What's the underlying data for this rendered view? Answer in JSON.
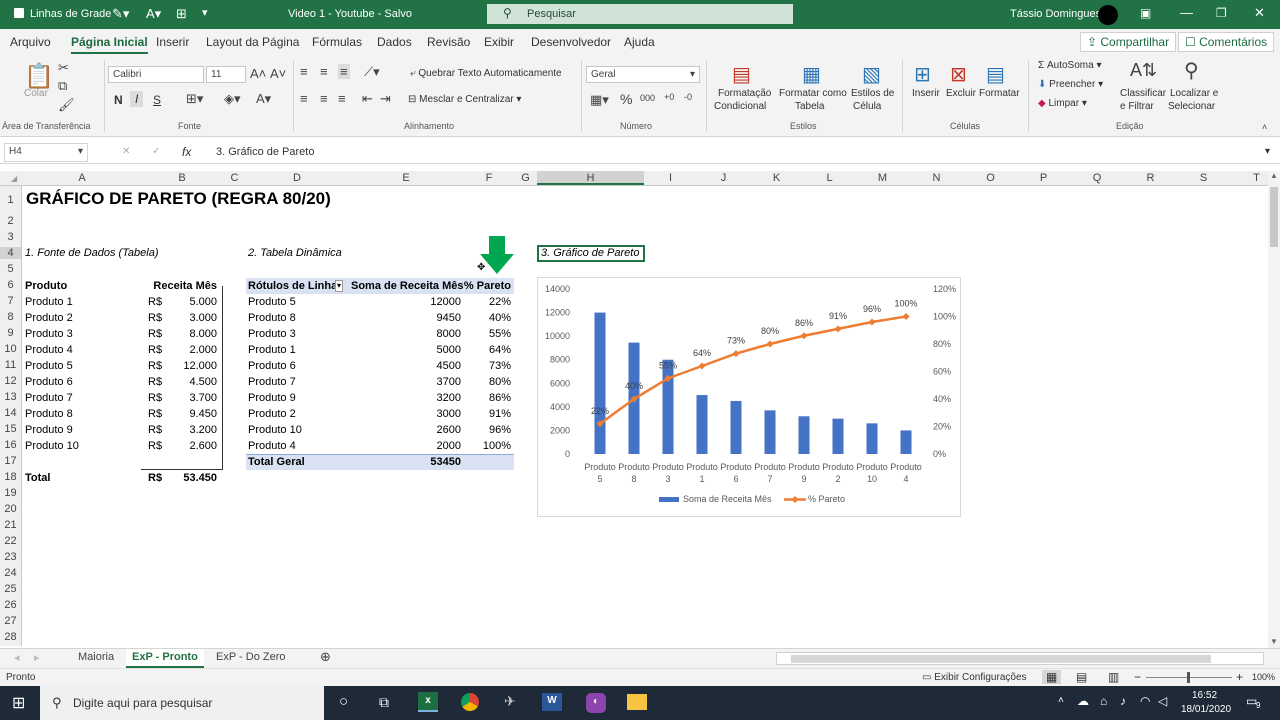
{
  "titlebar": {
    "gridlines_label": "Linhas de Grade",
    "doc_title": "Video 1 - Youtube  -  Salvo",
    "search_placeholder": "Pesquisar",
    "user_name": "Tássio Domingues"
  },
  "menu": [
    "Arquivo",
    "Página Inicial",
    "Inserir",
    "Layout da Página",
    "Fórmulas",
    "Dados",
    "Revisão",
    "Exibir",
    "Desenvolvedor",
    "Ajuda"
  ],
  "menu_right": {
    "share": "Compartilhar",
    "comments": "Comentários"
  },
  "ribbon": {
    "paste": "Colar",
    "font_name": "Calibri",
    "font_size": "11",
    "bold": "N",
    "italic": "I",
    "underline": "S",
    "wrap_text": "Quebrar Texto Automaticamente",
    "merge_center": "Mesclar e Centralizar",
    "number_format": "Geral",
    "cond_format": [
      "Formatação",
      "Condicional"
    ],
    "format_table": [
      "Formatar como",
      "Tabela"
    ],
    "cell_styles": [
      "Estilos de",
      "Célula"
    ],
    "insert": "Inserir",
    "delete": "Excluir",
    "format": "Formatar",
    "autosum": "AutoSoma",
    "fill": "Preencher",
    "clear": "Limpar",
    "sort_filter": [
      "Classificar",
      "e Filtrar"
    ],
    "find_select": [
      "Localizar e",
      "Selecionar"
    ],
    "groups": [
      "Área de Transferência",
      "Fonte",
      "Alinhamento",
      "Número",
      "Estilos",
      "Células",
      "Edição"
    ]
  },
  "formula_bar": {
    "name_box": "H4",
    "fx": "fx",
    "content": "3. Gráfico de Pareto"
  },
  "columns": [
    "A",
    "B",
    "C",
    "D",
    "E",
    "F",
    "G",
    "H",
    "I",
    "J",
    "K",
    "L",
    "M",
    "N",
    "O",
    "P",
    "Q",
    "R",
    "S",
    "T"
  ],
  "rows": [
    "1",
    "2",
    "3",
    "4",
    "5",
    "6",
    "7",
    "8",
    "9",
    "10",
    "11",
    "12",
    "13",
    "14",
    "15",
    "16",
    "17",
    "18",
    "19",
    "20",
    "21",
    "22",
    "23",
    "24",
    "25",
    "26",
    "27",
    "28"
  ],
  "sheet": {
    "title": "GRÁFICO DE PARETO (REGRA 80/20)",
    "sec1": "1. Fonte de Dados (Tabela)",
    "sec2": "2. Tabela Dinâmica",
    "sec3": "3. Gráfico de Pareto",
    "source_headers": [
      "Produto",
      "Receita Mês"
    ],
    "source_rows": [
      [
        "Produto 1",
        "R$",
        "5.000"
      ],
      [
        "Produto 2",
        "R$",
        "3.000"
      ],
      [
        "Produto 3",
        "R$",
        "8.000"
      ],
      [
        "Produto 4",
        "R$",
        "2.000"
      ],
      [
        "Produto 5",
        "R$",
        "12.000"
      ],
      [
        "Produto 6",
        "R$",
        "4.500"
      ],
      [
        "Produto 7",
        "R$",
        "3.700"
      ],
      [
        "Produto 8",
        "R$",
        "9.450"
      ],
      [
        "Produto 9",
        "R$",
        "3.200"
      ],
      [
        "Produto 10",
        "R$",
        "2.600"
      ]
    ],
    "source_total": [
      "Total",
      "R$",
      "53.450"
    ],
    "pivot_headers": [
      "Rótulos de Linha",
      "Soma de Receita Mês",
      "% Pareto"
    ],
    "pivot_rows": [
      [
        "Produto 5",
        "12000",
        "22%"
      ],
      [
        "Produto 8",
        "9450",
        "40%"
      ],
      [
        "Produto 3",
        "8000",
        "55%"
      ],
      [
        "Produto 1",
        "5000",
        "64%"
      ],
      [
        "Produto 6",
        "4500",
        "73%"
      ],
      [
        "Produto 7",
        "3700",
        "80%"
      ],
      [
        "Produto 9",
        "3200",
        "86%"
      ],
      [
        "Produto 2",
        "3000",
        "91%"
      ],
      [
        "Produto 10",
        "2600",
        "96%"
      ],
      [
        "Produto 4",
        "2000",
        "100%"
      ]
    ],
    "pivot_total": [
      "Total Geral",
      "53450"
    ]
  },
  "chart_data": {
    "type": "bar",
    "categories": [
      "Produto 5",
      "Produto 8",
      "Produto 3",
      "Produto 1",
      "Produto 6",
      "Produto 7",
      "Produto 9",
      "Produto 2",
      "Produto 10",
      "Produto 4"
    ],
    "series": [
      {
        "name": "Soma de Receita Mês",
        "type": "bar",
        "axis": "left",
        "color": "#4472c4",
        "values": [
          12000,
          9450,
          8000,
          5000,
          4500,
          3700,
          3200,
          3000,
          2600,
          2000
        ]
      },
      {
        "name": "% Pareto",
        "type": "line",
        "axis": "right",
        "color": "#ed7d31",
        "values": [
          22,
          40,
          55,
          64,
          73,
          80,
          86,
          91,
          96,
          100
        ]
      }
    ],
    "point_labels": [
      "22%",
      "40%",
      "55%",
      "64%",
      "73%",
      "80%",
      "86%",
      "91%",
      "96%",
      "100%"
    ],
    "y_left_ticks": [
      "0",
      "2000",
      "4000",
      "6000",
      "8000",
      "10000",
      "12000",
      "14000"
    ],
    "y_right_ticks": [
      "0%",
      "20%",
      "40%",
      "60%",
      "80%",
      "100%",
      "120%"
    ],
    "ylim_left": [
      0,
      14000
    ],
    "ylim_right": [
      0,
      120
    ],
    "legend": "bottom",
    "grid": false
  },
  "sheet_tabs": [
    "Maioria",
    "ExP - Pronto",
    "ExP - Do Zero"
  ],
  "active_tab": "ExP - Pronto",
  "status": {
    "ready": "Pronto",
    "display_settings": "Exibir Configurações",
    "zoom": "100%"
  },
  "taskbar": {
    "search_placeholder": "Digite aqui para pesquisar",
    "time": "16:52",
    "date": "18/01/2020",
    "notif_count": "9"
  }
}
